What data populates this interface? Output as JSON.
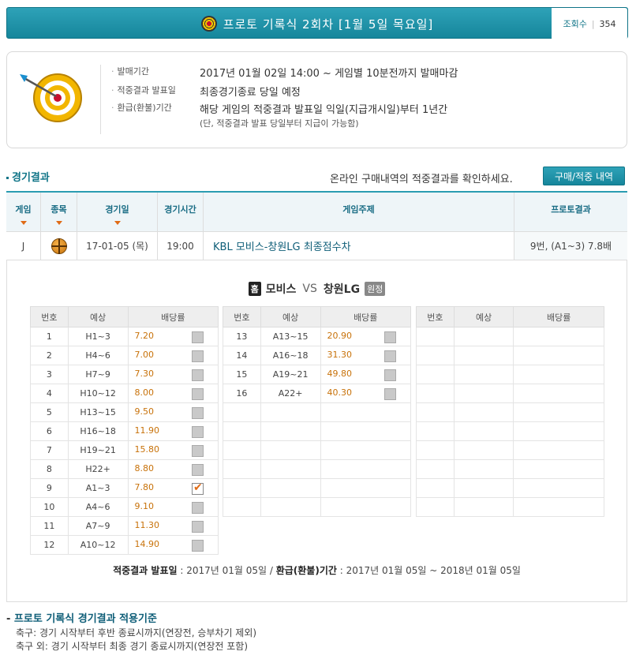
{
  "header": {
    "title": "프로토 기록식 2회차 [1월 5일 목요일]",
    "views_label": "조회수",
    "views_sep": "|",
    "views_count": "354"
  },
  "info": {
    "sale_label": "발매기간",
    "sale_value": "2017년 01월 02일 14:00 ~ 게임별 10분전까지 발매마감",
    "result_label": "적중결과 발표일",
    "result_value": "최종경기종료 당일 예정",
    "refund_label": "환급(환불)기간",
    "refund_value": "해당 게임의 적중결과 발표일 익일(지급개시일)부터 1년간",
    "refund_note": "(단, 적중결과 발표 당일부터 지급이 가능함)"
  },
  "section": {
    "title": "경기결과",
    "confirm_text": "온라인 구매내역의 적중결과를 확인하세요.",
    "button_label": "구매/적중 내역"
  },
  "table": {
    "headers": [
      "게임",
      "종목",
      "경기일",
      "경기시간",
      "게임주제",
      "프로토결과"
    ],
    "row": {
      "game": "J",
      "date": "17-01-05 (목)",
      "time": "19:00",
      "subject": "KBL 모비스-창원LG 최종점수차",
      "result": "9번, (A1~3) 7.8배"
    }
  },
  "match": {
    "home_badge": "홈",
    "home": "모비스",
    "vs": "VS",
    "away": "창원LG",
    "away_badge": "원정"
  },
  "odds_headers": [
    "번호",
    "예상",
    "배당률"
  ],
  "odds_col1": [
    {
      "no": "1",
      "pick": "H1~3",
      "rate": "7.20"
    },
    {
      "no": "2",
      "pick": "H4~6",
      "rate": "7.00"
    },
    {
      "no": "3",
      "pick": "H7~9",
      "rate": "7.30"
    },
    {
      "no": "4",
      "pick": "H10~12",
      "rate": "8.00"
    },
    {
      "no": "5",
      "pick": "H13~15",
      "rate": "9.50"
    },
    {
      "no": "6",
      "pick": "H16~18",
      "rate": "11.90"
    },
    {
      "no": "7",
      "pick": "H19~21",
      "rate": "15.80"
    },
    {
      "no": "8",
      "pick": "H22+",
      "rate": "8.80"
    },
    {
      "no": "9",
      "pick": "A1~3",
      "rate": "7.80",
      "checked": true
    },
    {
      "no": "10",
      "pick": "A4~6",
      "rate": "9.10"
    },
    {
      "no": "11",
      "pick": "A7~9",
      "rate": "11.30"
    },
    {
      "no": "12",
      "pick": "A10~12",
      "rate": "14.90"
    }
  ],
  "odds_col2": [
    {
      "no": "13",
      "pick": "A13~15",
      "rate": "20.90"
    },
    {
      "no": "14",
      "pick": "A16~18",
      "rate": "31.30"
    },
    {
      "no": "15",
      "pick": "A19~21",
      "rate": "49.80"
    },
    {
      "no": "16",
      "pick": "A22+",
      "rate": "40.30"
    }
  ],
  "footer": {
    "result_label": "적중결과 발표일",
    "result_value": " : 2017년 01월 05일 / ",
    "refund_label": "환급(환불)기간",
    "refund_value": " : 2017년 01월 05일 ~ 2018년 01월 05일"
  },
  "rules": {
    "title": "프로토 기록식 경기결과 적용기준",
    "line1": "축구: 경기 시작부터 후반 종료시까지(연장전, 승부차기 제외)",
    "line2": "축구 외: 경기 시작부터 최종 경기 종료시까지(연장전 포함)"
  }
}
